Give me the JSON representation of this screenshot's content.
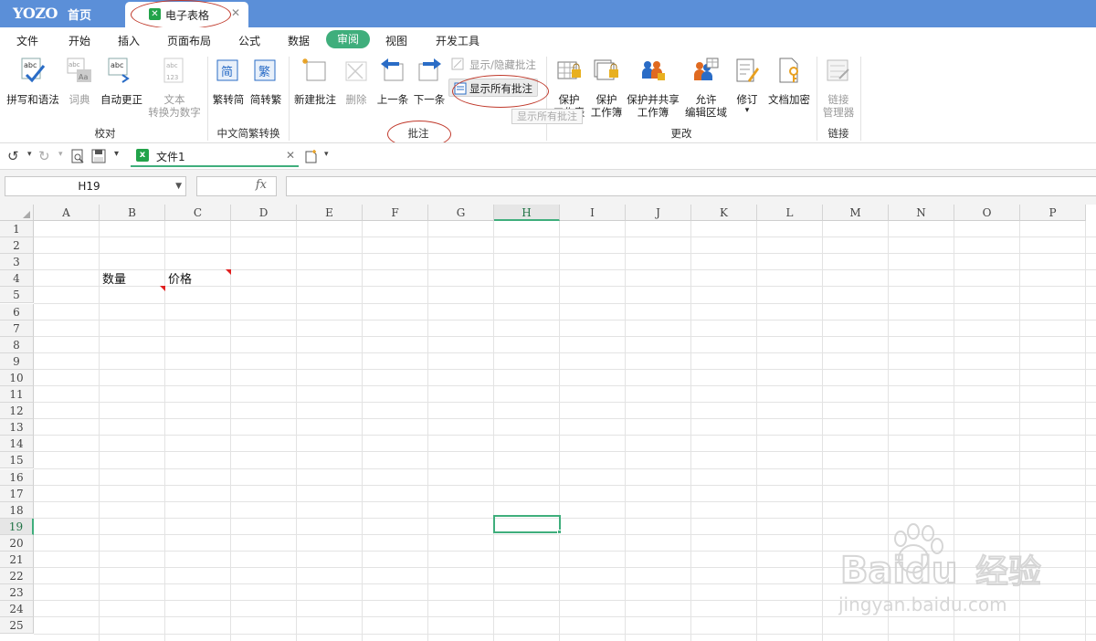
{
  "titlebar": {
    "logo": "YOZO",
    "home_tab": "首页",
    "doc_tab": "电子表格",
    "doc_tab_close": "✕"
  },
  "menubar": {
    "items": [
      "文件",
      "开始",
      "插入",
      "页面布局",
      "公式",
      "数据",
      "审阅",
      "视图",
      "开发工具"
    ],
    "active": "审阅"
  },
  "ribbon": {
    "spell_check": "拼写和语法",
    "dictionary": "词典",
    "auto_correct": "自动更正",
    "text_to_number_1": "文本",
    "text_to_number_2": "转换为数字",
    "group_proofing": "校对",
    "trad_to_simp": "繁转简",
    "simp_to_trad": "简转繁",
    "group_chinese": "中文简繁转换",
    "new_comment": "新建批注",
    "delete": "删除",
    "prev": "上一条",
    "next": "下一条",
    "show_hide_comment": "显示/隐藏批注",
    "show_all_comments": "显示所有批注",
    "group_comments": "批注",
    "protect_sheet_1": "保护",
    "protect_sheet_2": "工作表",
    "protect_book_1": "保护",
    "protect_book_2": "工作簿",
    "protect_share_1": "保护并共享",
    "protect_share_2": "工作簿",
    "allow_edit_1": "允许",
    "allow_edit_2": "编辑区域",
    "revise": "修订",
    "revise_arrow": "▾",
    "doc_encrypt": "文档加密",
    "group_changes": "更改",
    "link_manager_1": "链接",
    "link_manager_2": "管理器",
    "group_links": "链接",
    "tooltip": "显示所有批注",
    "show_all_badge": "≡"
  },
  "toolbar2": {
    "undo": "↺",
    "redo": "↻",
    "dropdown": "▾",
    "file_tab_label": "文件1",
    "file_tab_close": "✕",
    "file_icon": "x"
  },
  "formulabar": {
    "name_box": "H19",
    "name_box_arrow": "▼",
    "fx": "fx",
    "formula": ""
  },
  "sheet": {
    "columns": [
      "A",
      "B",
      "C",
      "D",
      "E",
      "F",
      "G",
      "H",
      "I",
      "J",
      "K",
      "L",
      "M",
      "N",
      "O",
      "P"
    ],
    "rows": [
      "1",
      "2",
      "3",
      "4",
      "5",
      "6",
      "7",
      "8",
      "9",
      "10",
      "11",
      "12",
      "13",
      "14",
      "15",
      "16",
      "17",
      "18",
      "19",
      "20",
      "21",
      "22",
      "23",
      "24",
      "25"
    ],
    "selected_cell": "H19",
    "cells": {
      "B4": "数量",
      "C4": "价格"
    },
    "comment_indicators": [
      "B4",
      "C4"
    ]
  },
  "watermark": {
    "brand": "Baidu",
    "brand_cn": "经验",
    "url": "jingyan.baidu.com"
  },
  "colors": {
    "titlebar": "#5b8fd8",
    "accent": "#3fae7c",
    "annotation": "#c0392b",
    "comment_marker": "#e02020"
  }
}
